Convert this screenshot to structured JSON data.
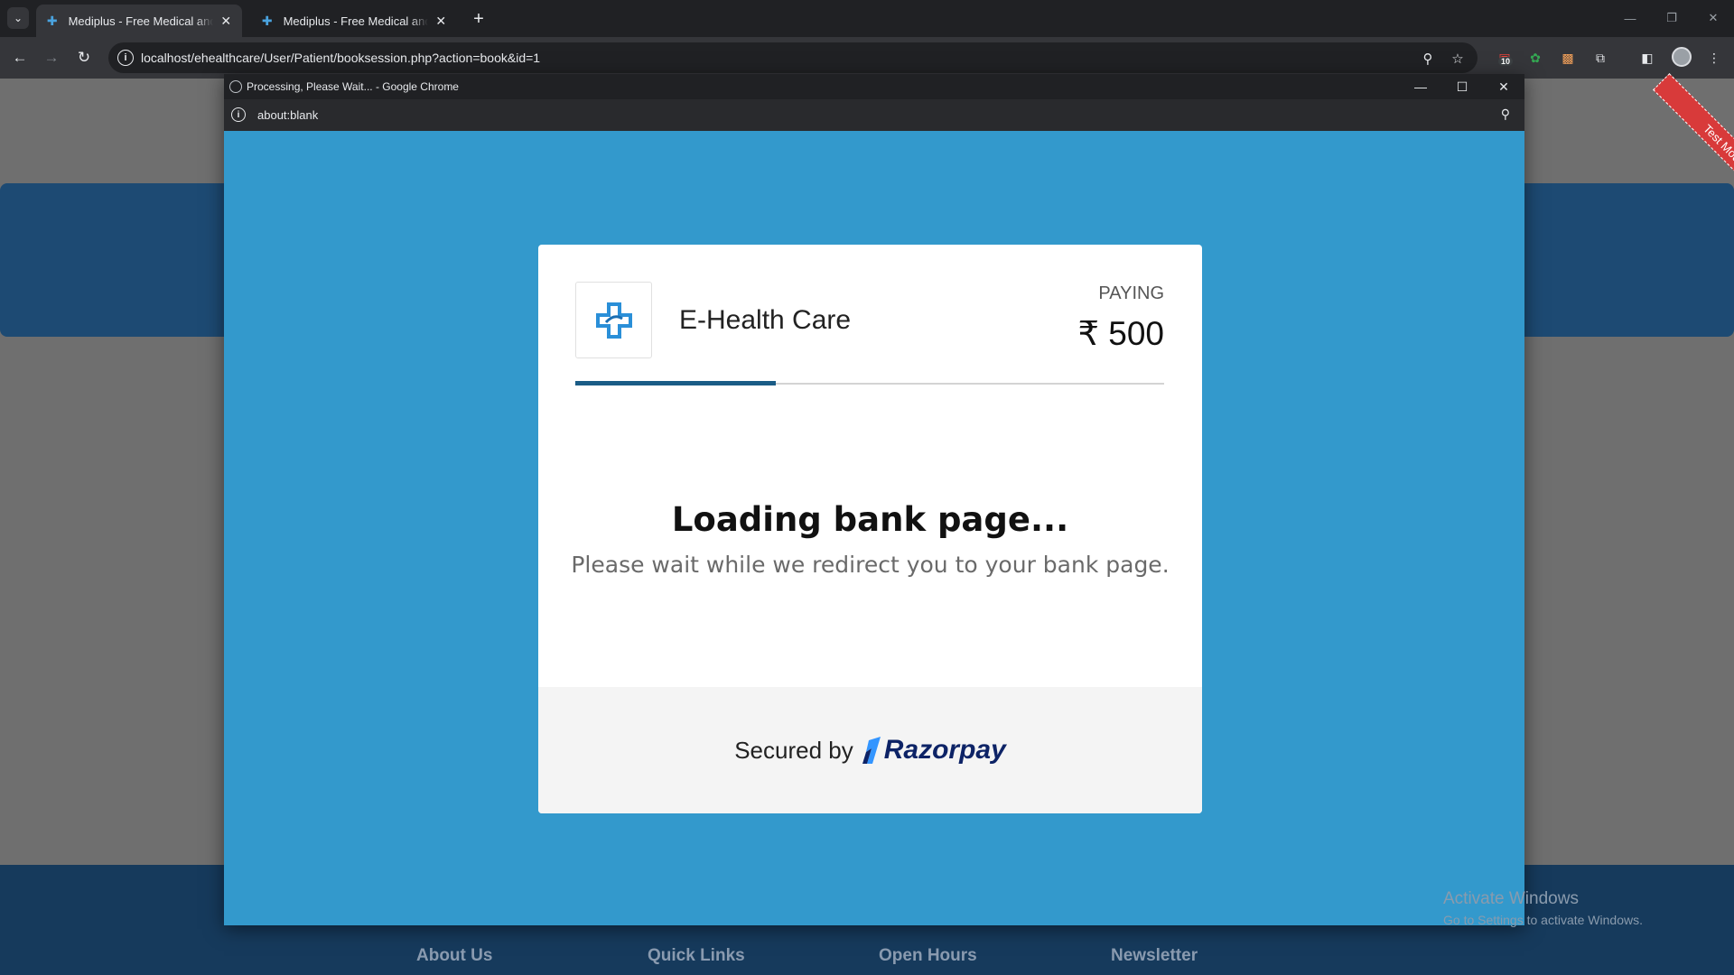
{
  "browser": {
    "tabs": [
      {
        "title": "Mediplus - Free Medical and Doctor Directory HTML Template",
        "active": true
      },
      {
        "title": "Mediplus - Free Medical and Doctor Directory HTML Template",
        "active": false
      }
    ],
    "url": "localhost/ehealthcare/User/Patient/booksession.php?action=book&id=1",
    "extension_badge": "10"
  },
  "background_page": {
    "footer_headings": [
      "About Us",
      "Quick Links",
      "Open Hours",
      "Newsletter"
    ],
    "test_mode_ribbon": "Test Mode"
  },
  "popup": {
    "window_title": "Processing, Please Wait... - Google Chrome",
    "url": "about:blank"
  },
  "checkout": {
    "merchant_name": "E-Health Care",
    "paying_label": "PAYING",
    "amount": "₹ 500",
    "progress_fraction": 0.34,
    "loading_title": "Loading bank page...",
    "loading_message": "Please wait while we redirect you to your bank page.",
    "secured_by": "Secured by",
    "brand": "Razorpay"
  },
  "windows_watermark": {
    "line1": "Activate Windows",
    "line2": "Go to Settings to activate Windows."
  },
  "colors": {
    "popup_bg": "#3399cc",
    "progress": "#1a5c86",
    "brand_dark": "#0d2366",
    "brand_accent": "#3395ff"
  }
}
